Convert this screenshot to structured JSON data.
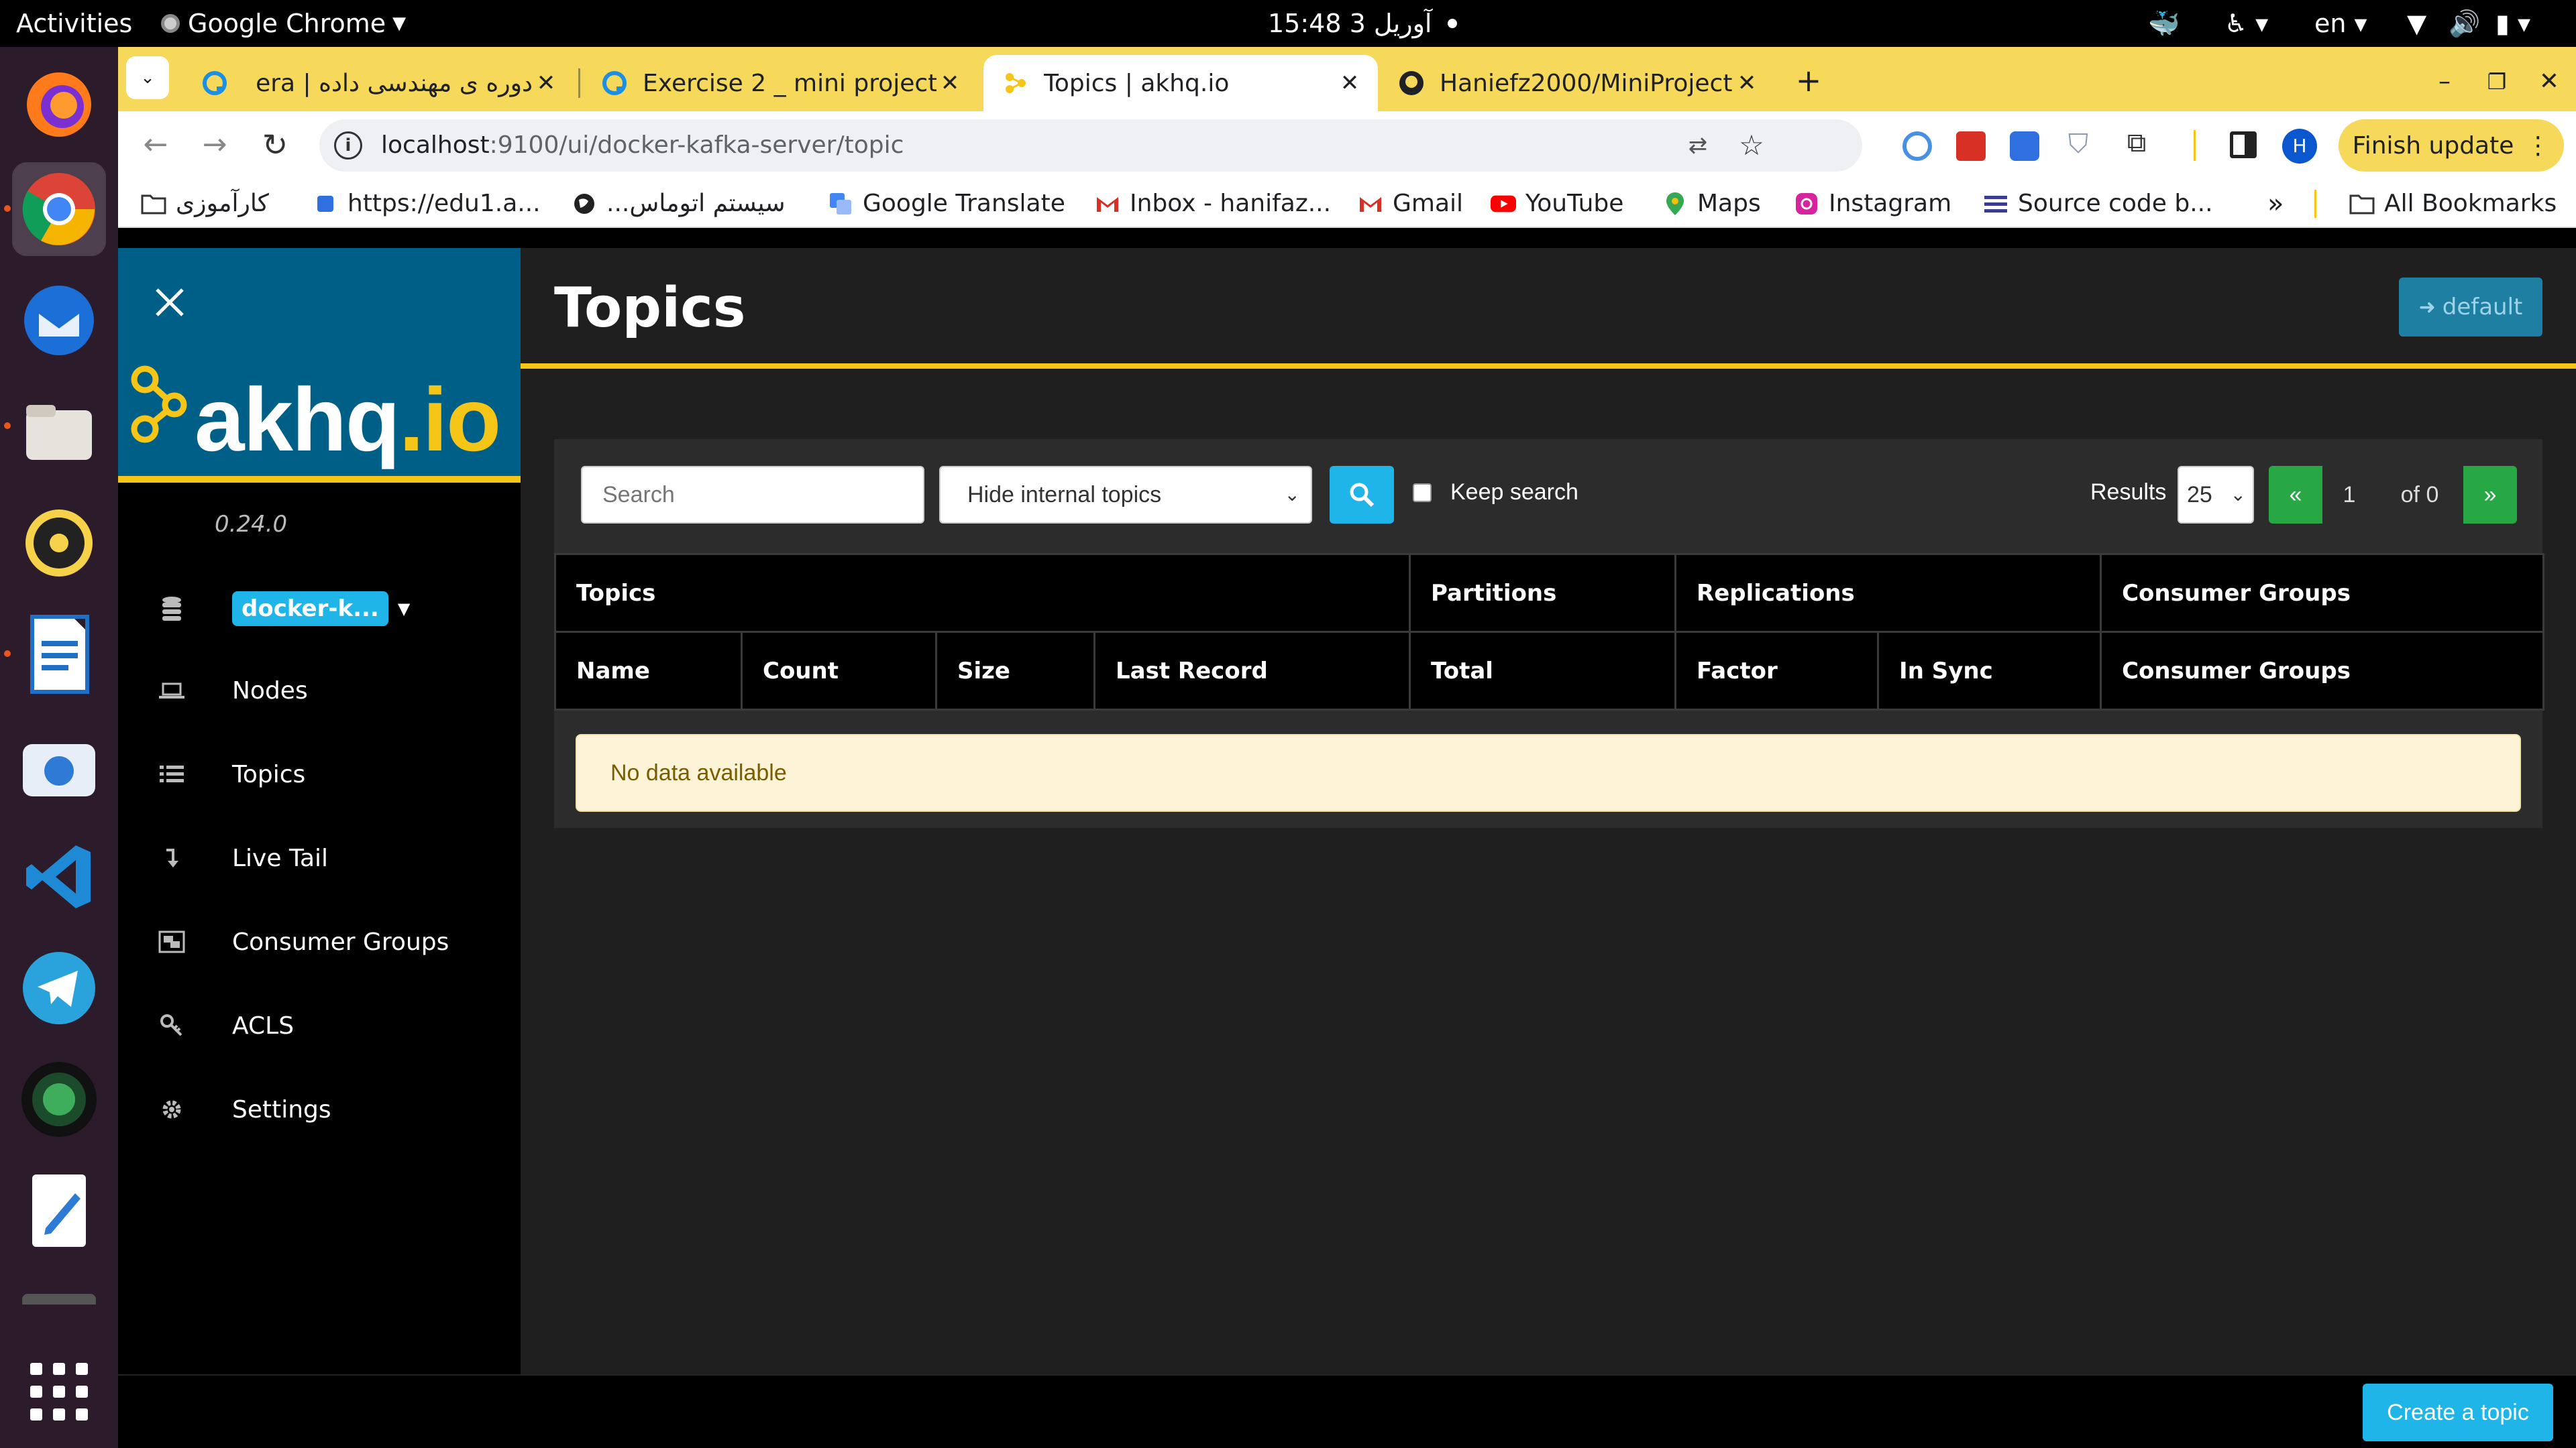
{
  "os": {
    "activities": "Activities",
    "app_name": "Google Chrome",
    "clock": "15:48 آوریل 3",
    "keyboard_layout": "en"
  },
  "browser": {
    "tabs": [
      {
        "title": "دوره ی مهندسی داده | era"
      },
      {
        "title": "Exercise 2 _ mini project"
      },
      {
        "title": "Topics | akhq.io"
      },
      {
        "title": "Haniefz2000/MiniProject"
      }
    ],
    "url_host": "localhost",
    "url_path": ":9100/ui/docker-kafka-server/topic",
    "profile_initial": "H",
    "finish_update": "Finish update",
    "bookmarks": [
      {
        "label": "کارآموزی",
        "icon": "folder-icon"
      },
      {
        "label": "https://edu1.a...",
        "icon": "globe-icon"
      },
      {
        "label": "سیستم اتوماس...",
        "icon": "globe-icon"
      },
      {
        "label": "Google Translate",
        "icon": "translate-icon"
      },
      {
        "label": "Inbox - hanifaz...",
        "icon": "gmail-icon"
      },
      {
        "label": "Gmail",
        "icon": "gmail-icon"
      },
      {
        "label": "YouTube",
        "icon": "youtube-icon"
      },
      {
        "label": "Maps",
        "icon": "maps-icon"
      },
      {
        "label": "Instagram",
        "icon": "instagram-icon"
      },
      {
        "label": "Source code b...",
        "icon": "list-icon"
      }
    ],
    "more_bookmarks": "»",
    "all_bookmarks": "All Bookmarks"
  },
  "app": {
    "version": "0.24.0",
    "cluster": "docker-k...",
    "nav": [
      {
        "label": "Nodes",
        "icon": "laptop-icon"
      },
      {
        "label": "Topics",
        "icon": "list-icon"
      },
      {
        "label": "Live Tail",
        "icon": "level-down-icon"
      },
      {
        "label": "Consumer Groups",
        "icon": "object-group-icon"
      },
      {
        "label": "ACLS",
        "icon": "key-icon"
      },
      {
        "label": "Settings",
        "icon": "gear-icon"
      }
    ],
    "page_title": "Topics",
    "user_button": "default"
  },
  "filters": {
    "search_placeholder": "Search",
    "topic_filter": "Hide internal topics",
    "keep_search": "Keep search",
    "results_label": "Results",
    "page_size": "25",
    "first_page": "«",
    "current_page": "1",
    "of_pages": "of 0",
    "next_page": "»"
  },
  "table": {
    "group_headers": [
      "Topics",
      "Partitions",
      "Replications",
      "Consumer Groups"
    ],
    "columns": [
      "Name",
      "Count",
      "Size",
      "Last Record",
      "Total",
      "Factor",
      "In Sync",
      "Consumer Groups"
    ],
    "empty_message": "No data available"
  },
  "footer": {
    "create_topic": "Create a topic"
  },
  "colors": {
    "accent_yellow": "#f5c518",
    "brand_blue": "#005f87",
    "search_button": "#1fb5e8",
    "pagination_green": "#28a745",
    "empty_state_bg": "#fdf4d7",
    "empty_state_text": "#7a5d00"
  }
}
